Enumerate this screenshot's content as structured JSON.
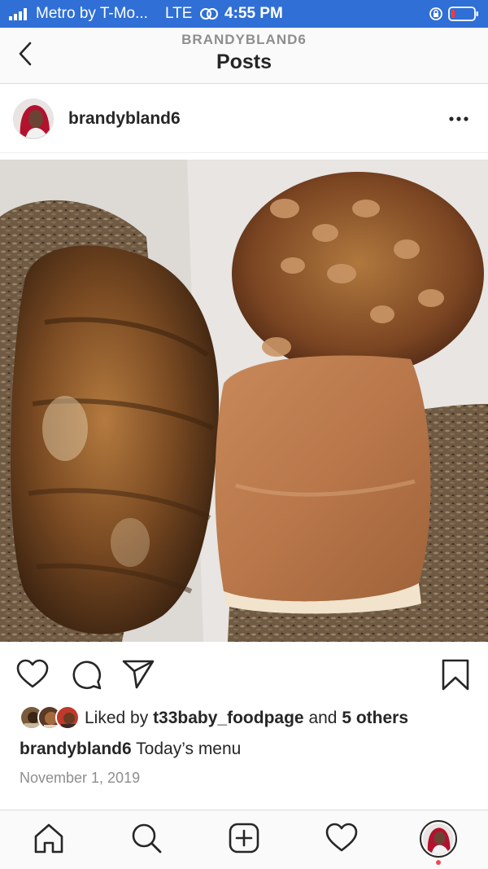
{
  "status_bar": {
    "carrier": "Metro by T-Mo...",
    "network": "LTE",
    "time": "4:55 PM",
    "background_color": "#2f6fd6"
  },
  "header": {
    "subtitle": "BRANDYBLAND6",
    "title": "Posts",
    "back_icon": "chevron-left-icon"
  },
  "post": {
    "username": "brandybland6",
    "more_icon": "ellipsis-icon",
    "image_description_icon": "food-photo",
    "actions": {
      "like_icon": "heart-icon",
      "comment_icon": "comment-icon",
      "share_icon": "paper-plane-icon",
      "save_icon": "bookmark-icon"
    },
    "likes": {
      "prefix": "Liked by ",
      "first_liker": "t33baby_foodpage",
      "conjunction": " and ",
      "others": "5 others"
    },
    "caption": {
      "username": "brandybland6",
      "text": " Today’s menu"
    },
    "date": "November 1, 2019"
  },
  "tab_bar": {
    "home_icon": "home-icon",
    "search_icon": "search-icon",
    "add_icon": "add-post-icon",
    "activity_icon": "heart-icon",
    "profile_icon": "profile-avatar",
    "notification_color": "#ed4956"
  }
}
